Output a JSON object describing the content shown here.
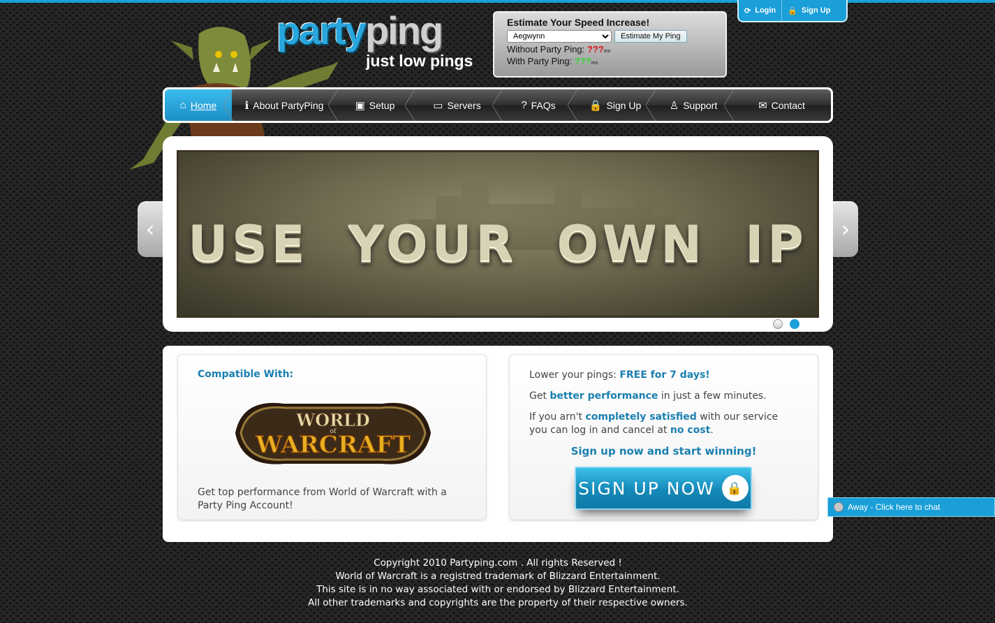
{
  "logo": {
    "party": "party",
    "ping": "ping",
    "tagline": "just low pings"
  },
  "estimator": {
    "title": "Estimate Your Speed Increase!",
    "server_selected": "Aegwynn",
    "button": "Estimate My Ping",
    "without_label": "Without Party Ping:",
    "without_value": "???",
    "with_label": "With Party Ping:",
    "with_value": "???",
    "unit": "ms"
  },
  "account": {
    "login": "Login",
    "signup": "Sign Up"
  },
  "nav": {
    "items": [
      {
        "label": "Home",
        "icon": "home-icon"
      },
      {
        "label": "About PartyPing",
        "icon": "info-icon"
      },
      {
        "label": "Setup",
        "icon": "disk-icon"
      },
      {
        "label": "Servers",
        "icon": "computer-icon"
      },
      {
        "label": "FAQs",
        "icon": "question-icon"
      },
      {
        "label": "Sign Up",
        "icon": "lock-icon"
      },
      {
        "label": "Support",
        "icon": "person-icon"
      },
      {
        "label": "Contact",
        "icon": "envelope-icon"
      }
    ]
  },
  "slider": {
    "headline": "USE YOUR OWN IP",
    "active_dot": 2
  },
  "compatible": {
    "title": "Compatible With:",
    "logo_top": "WORLD",
    "logo_of": "of",
    "logo_bottom": "WARCRAFT",
    "desc": "Get top performance from World of Warcraft with a Party Ping Account!"
  },
  "promo": {
    "line1_pre": "Lower your pings: ",
    "line1_em": "FREE for 7 days!",
    "line2_pre": "Get ",
    "line2_em": "better performance",
    "line2_post": " in just a few minutes.",
    "line3_pre": "If you arn't ",
    "line3_em": "completely satisfied",
    "line3_mid": " with our service you can log in and cancel at ",
    "line3_em2": "no cost",
    "line3_post": ".",
    "cta": "Sign up now and start winning!",
    "button": "SIGN UP NOW"
  },
  "chat": {
    "label": "Away - Click here to chat"
  },
  "footer": {
    "line1": "Copyright 2010 Partyping.com . All rights Reserved !",
    "line2": "World of Warcraft is a registred trademark of Blizzard Entertainment.",
    "line3": "This site is in no way associated with or endorsed by Blizzard Entertainment.",
    "line4": "All other trademarks and copyrights are the property of their respective owners."
  }
}
